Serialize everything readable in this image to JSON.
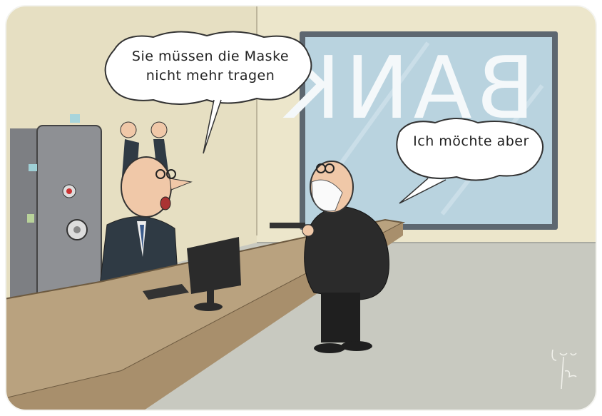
{
  "cartoon": {
    "speech_teller": "Sie müssen die Maske nicht mehr tragen",
    "speech_robber": "Ich möchte aber",
    "window_sign": "BANK",
    "signature": "Lars 22"
  },
  "colors": {
    "wall": "#ece6cb",
    "floor": "#c8c9c0",
    "window": "#b9d3df",
    "counter_top": "#b9a27f",
    "counter_front": "#a88f6c",
    "safe": "#8e9094",
    "suit": "#2f3a44",
    "robber": "#2b2b2b"
  }
}
